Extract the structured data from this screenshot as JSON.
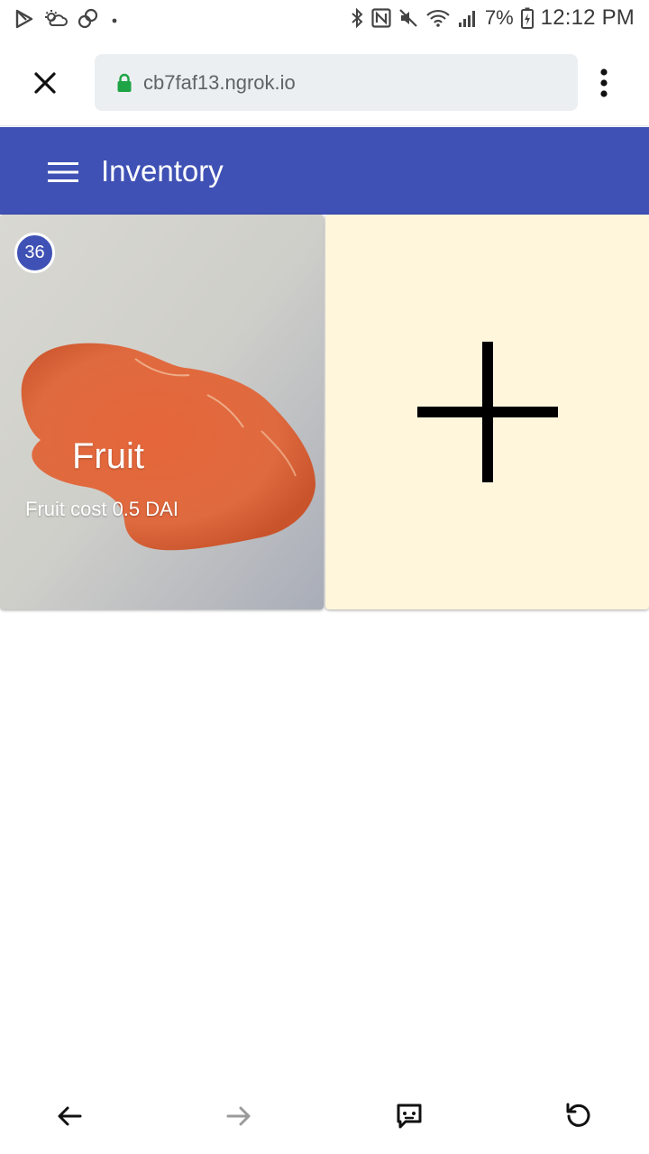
{
  "status_bar": {
    "battery": "7%",
    "time": "12:12 PM",
    "icons_left": [
      "play-store-icon",
      "weather-icon",
      "link-icon",
      "dot-icon"
    ],
    "icons_right": [
      "bluetooth-icon",
      "nfc-icon",
      "mute-icon",
      "wifi-icon",
      "signal-icon",
      "battery-icon"
    ]
  },
  "browser": {
    "url": "cb7faf13.ngrok.io",
    "secure_color": "#1ea446"
  },
  "app_bar": {
    "title": "Inventory",
    "color": "#3f51b5"
  },
  "inventory": {
    "items": [
      {
        "count": "36",
        "name": "Fruit",
        "subtitle": "Fruit cost 0.5 DAI"
      }
    ],
    "add_tile_color": "#fff6dc"
  },
  "bottom_nav": {
    "icons": [
      "back-arrow-icon",
      "forward-arrow-icon",
      "feedback-icon",
      "refresh-icon"
    ]
  }
}
